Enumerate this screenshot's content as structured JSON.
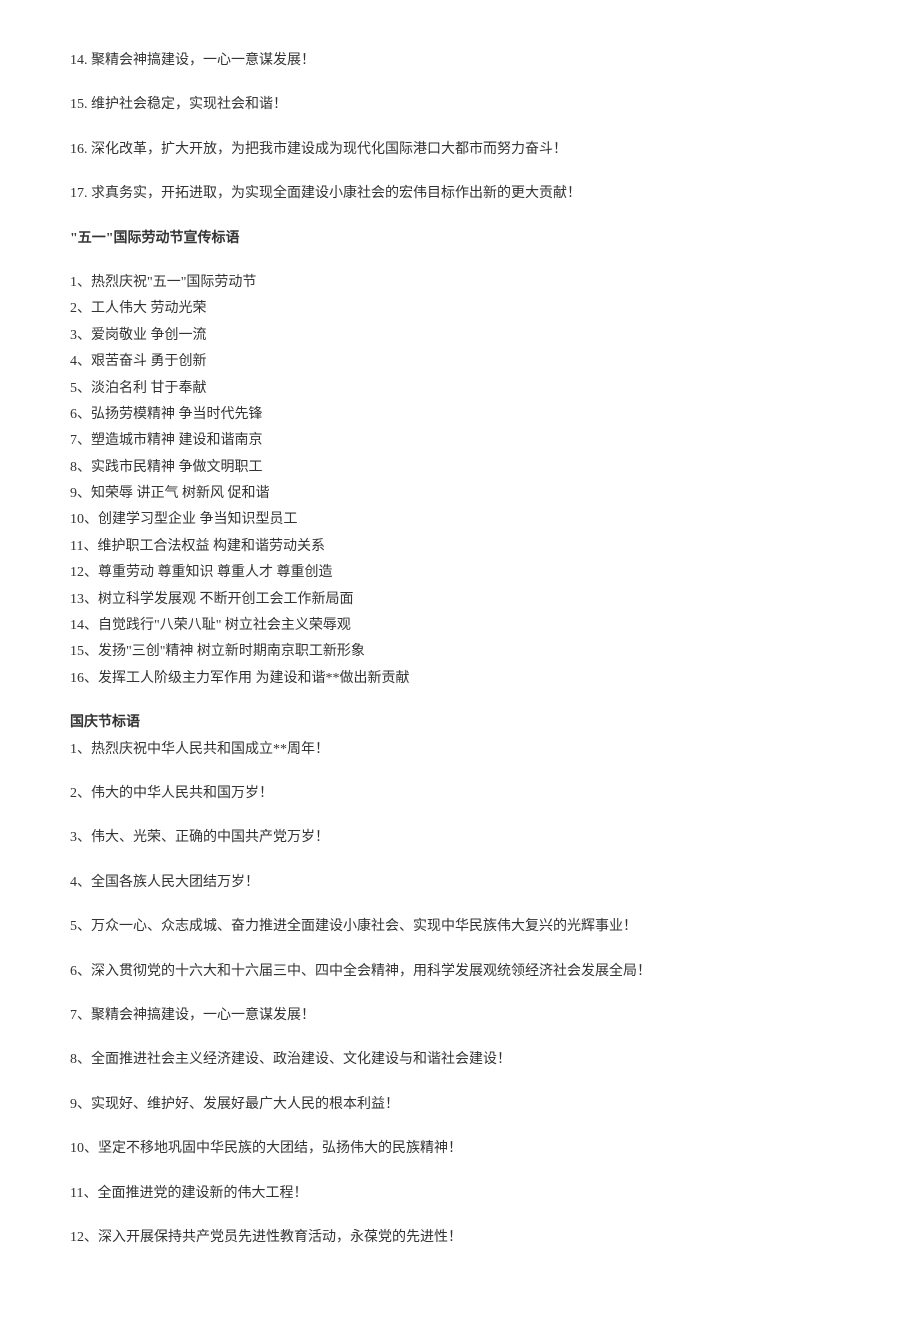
{
  "section_a": {
    "items": [
      "14. 聚精会神搞建设，一心一意谋发展！",
      "15. 维护社会稳定，实现社会和谐！",
      "16. 深化改革，扩大开放，为把我市建设成为现代化国际港口大都市而努力奋斗！",
      "17. 求真务实，开拓进取，为实现全面建设小康社会的宏伟目标作出新的更大贡献！"
    ]
  },
  "section_b": {
    "heading": "\"五一\"国际劳动节宣传标语",
    "items": [
      "1、热烈庆祝\"五一\"国际劳动节",
      "2、工人伟大 劳动光荣",
      "3、爱岗敬业 争创一流",
      "4、艰苦奋斗 勇于创新",
      "5、淡泊名利 甘于奉献",
      "6、弘扬劳模精神 争当时代先锋",
      "7、塑造城市精神 建设和谐南京",
      "8、实践市民精神 争做文明职工",
      "9、知荣辱 讲正气 树新风 促和谐",
      "10、创建学习型企业 争当知识型员工",
      "11、维护职工合法权益 构建和谐劳动关系",
      "12、尊重劳动 尊重知识 尊重人才 尊重创造",
      "13、树立科学发展观 不断开创工会工作新局面",
      "14、自觉践行\"八荣八耻\" 树立社会主义荣辱观",
      "15、发扬\"三创\"精神 树立新时期南京职工新形象",
      "16、发挥工人阶级主力军作用 为建设和谐**做出新贡献"
    ]
  },
  "section_c": {
    "heading": "国庆节标语",
    "items": [
      "1、热烈庆祝中华人民共和国成立**周年！",
      "2、伟大的中华人民共和国万岁！",
      "3、伟大、光荣、正确的中国共产党万岁！",
      "4、全国各族人民大团结万岁！",
      "5、万众一心、众志成城、奋力推进全面建设小康社会、实现中华民族伟大复兴的光辉事业！",
      "6、深入贯彻党的十六大和十六届三中、四中全会精神，用科学发展观统领经济社会发展全局！",
      "7、聚精会神搞建设，一心一意谋发展！",
      "8、全面推进社会主义经济建设、政治建设、文化建设与和谐社会建设！",
      "9、实现好、维护好、发展好最广大人民的根本利益！",
      "10、坚定不移地巩固中华民族的大团结，弘扬伟大的民族精神！",
      "11、全面推进党的建设新的伟大工程！",
      "12、深入开展保持共产党员先进性教育活动，永葆党的先进性！"
    ]
  }
}
